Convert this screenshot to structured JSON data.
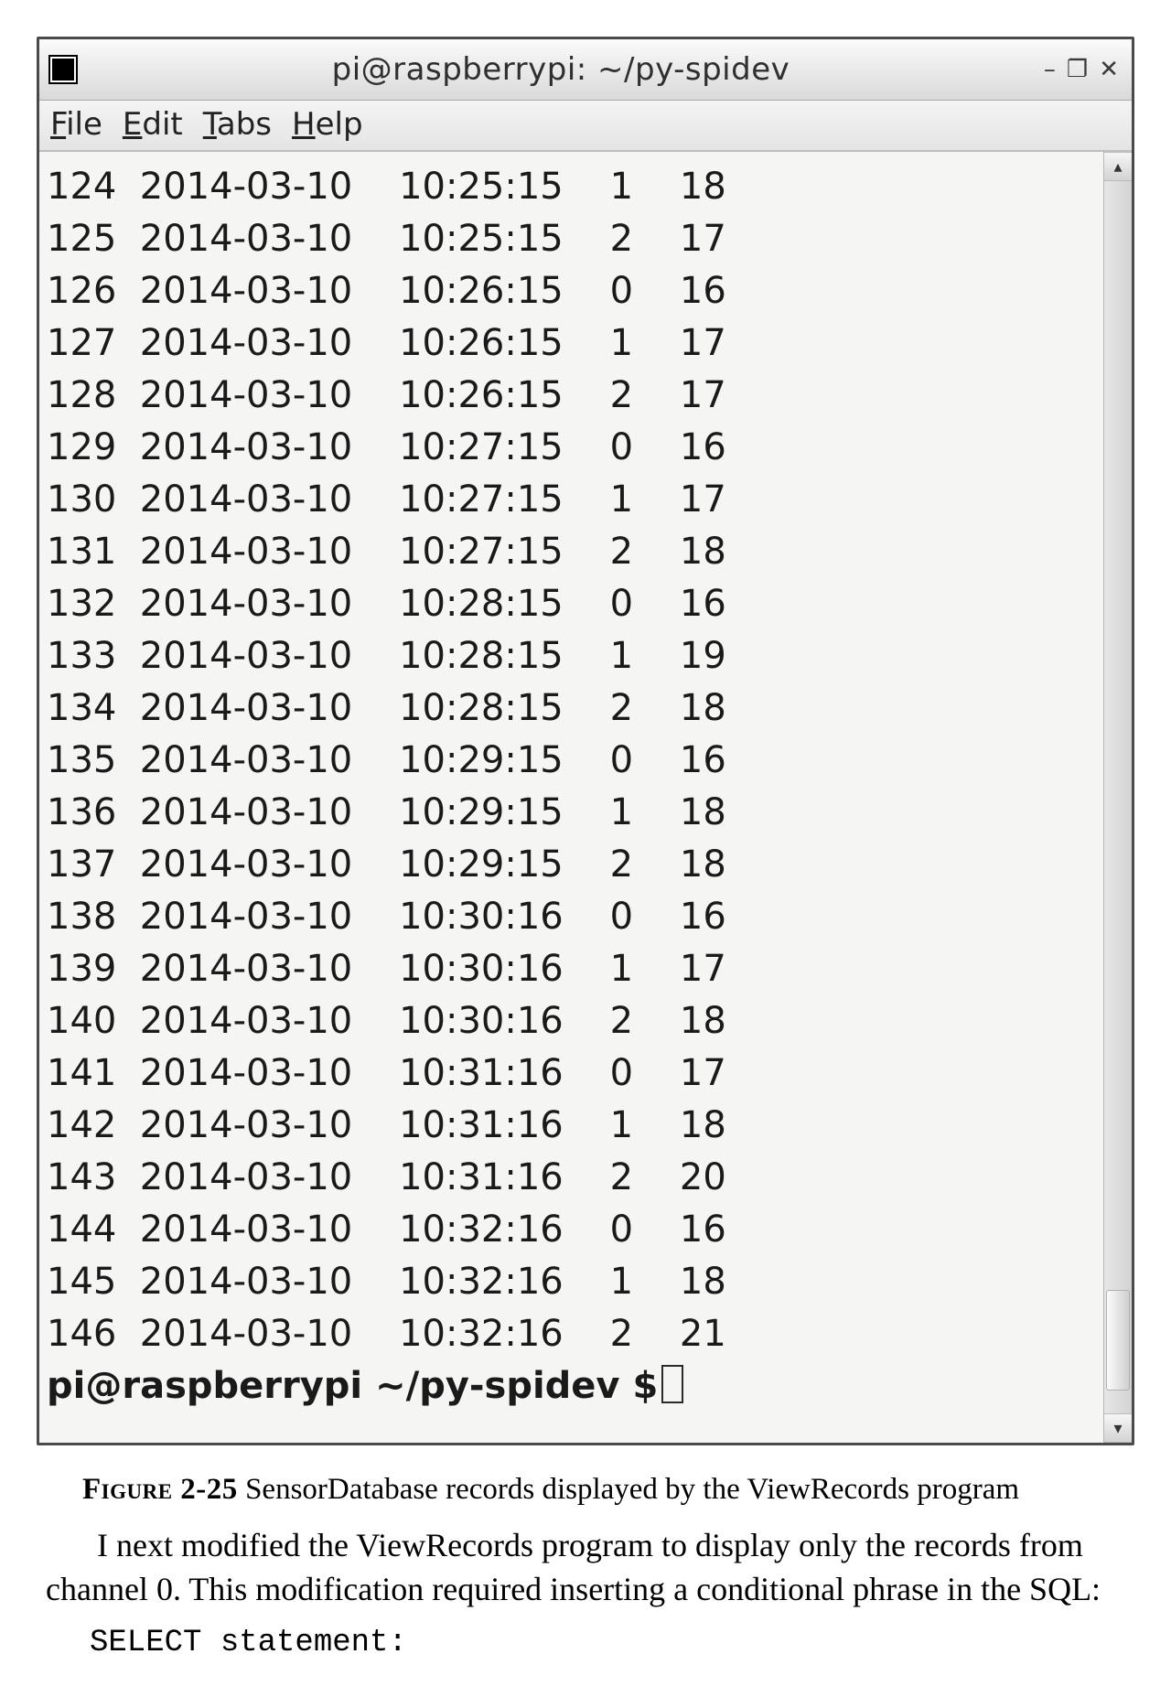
{
  "window": {
    "title": "pi@raspberrypi: ~/py-spidev",
    "buttons": {
      "min": "–",
      "max": "❐",
      "close": "✕"
    }
  },
  "menu": {
    "file": {
      "hot": "F",
      "rest": "ile"
    },
    "edit": {
      "hot": "E",
      "rest": "dit"
    },
    "tabs": {
      "hot": "T",
      "rest": "abs"
    },
    "help": {
      "hot": "H",
      "rest": "elp"
    }
  },
  "records": [
    {
      "id": "124",
      "date": "2014-03-10",
      "time": "10:25:15",
      "ch": "1",
      "val": "18"
    },
    {
      "id": "125",
      "date": "2014-03-10",
      "time": "10:25:15",
      "ch": "2",
      "val": "17"
    },
    {
      "id": "126",
      "date": "2014-03-10",
      "time": "10:26:15",
      "ch": "0",
      "val": "16"
    },
    {
      "id": "127",
      "date": "2014-03-10",
      "time": "10:26:15",
      "ch": "1",
      "val": "17"
    },
    {
      "id": "128",
      "date": "2014-03-10",
      "time": "10:26:15",
      "ch": "2",
      "val": "17"
    },
    {
      "id": "129",
      "date": "2014-03-10",
      "time": "10:27:15",
      "ch": "0",
      "val": "16"
    },
    {
      "id": "130",
      "date": "2014-03-10",
      "time": "10:27:15",
      "ch": "1",
      "val": "17"
    },
    {
      "id": "131",
      "date": "2014-03-10",
      "time": "10:27:15",
      "ch": "2",
      "val": "18"
    },
    {
      "id": "132",
      "date": "2014-03-10",
      "time": "10:28:15",
      "ch": "0",
      "val": "16"
    },
    {
      "id": "133",
      "date": "2014-03-10",
      "time": "10:28:15",
      "ch": "1",
      "val": "19"
    },
    {
      "id": "134",
      "date": "2014-03-10",
      "time": "10:28:15",
      "ch": "2",
      "val": "18"
    },
    {
      "id": "135",
      "date": "2014-03-10",
      "time": "10:29:15",
      "ch": "0",
      "val": "16"
    },
    {
      "id": "136",
      "date": "2014-03-10",
      "time": "10:29:15",
      "ch": "1",
      "val": "18"
    },
    {
      "id": "137",
      "date": "2014-03-10",
      "time": "10:29:15",
      "ch": "2",
      "val": "18"
    },
    {
      "id": "138",
      "date": "2014-03-10",
      "time": "10:30:16",
      "ch": "0",
      "val": "16"
    },
    {
      "id": "139",
      "date": "2014-03-10",
      "time": "10:30:16",
      "ch": "1",
      "val": "17"
    },
    {
      "id": "140",
      "date": "2014-03-10",
      "time": "10:30:16",
      "ch": "2",
      "val": "18"
    },
    {
      "id": "141",
      "date": "2014-03-10",
      "time": "10:31:16",
      "ch": "0",
      "val": "17"
    },
    {
      "id": "142",
      "date": "2014-03-10",
      "time": "10:31:16",
      "ch": "1",
      "val": "18"
    },
    {
      "id": "143",
      "date": "2014-03-10",
      "time": "10:31:16",
      "ch": "2",
      "val": "20"
    },
    {
      "id": "144",
      "date": "2014-03-10",
      "time": "10:32:16",
      "ch": "0",
      "val": "16"
    },
    {
      "id": "145",
      "date": "2014-03-10",
      "time": "10:32:16",
      "ch": "1",
      "val": "18"
    },
    {
      "id": "146",
      "date": "2014-03-10",
      "time": "10:32:16",
      "ch": "2",
      "val": "21"
    }
  ],
  "prompt": {
    "userhost": "pi@raspberrypi",
    "path": "~/py-spidev",
    "symbol": "$"
  },
  "caption": {
    "label": "Figure 2-25",
    "text": " SensorDatabase records displayed by the ViewRecords program"
  },
  "para": "I next modified the ViewRecords program to display only the records from channel 0. This modification required inserting a conditional phrase in the SQL:",
  "code": "SELECT statement:"
}
